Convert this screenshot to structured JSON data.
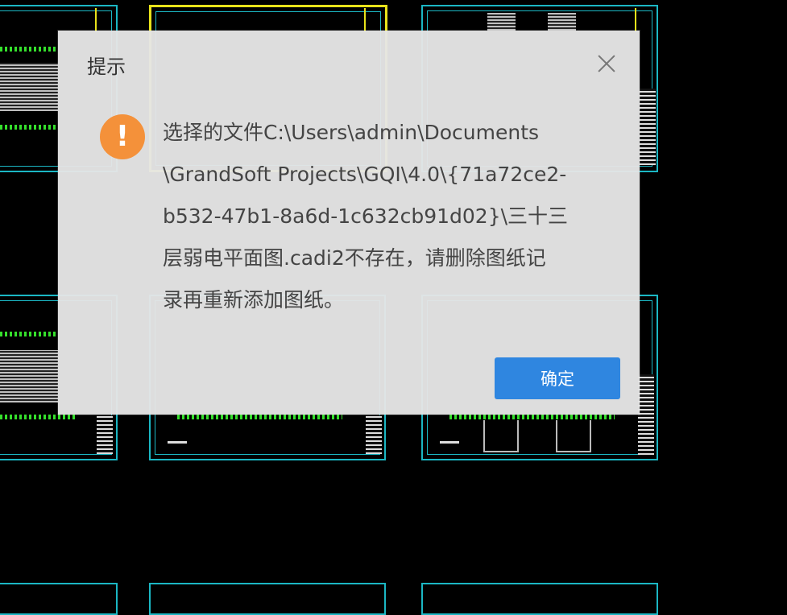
{
  "dialog": {
    "title": "提示",
    "message_lines": [
      "选择的文件C:\\Users\\admin\\Documents",
      "\\GrandSoft Projects\\GQI\\4.0\\{71a72ce2-",
      "b532-47b1-8a6d-1c632cb91d02}\\三十三",
      "层弱电平面图.cadi2不存在，请删除图纸记",
      "录再重新添加图纸。"
    ],
    "ok_label": "确定",
    "icon": "warning-icon",
    "close_icon": "close-icon"
  },
  "colors": {
    "accent": "#2f86e0",
    "warning": "#f4913a",
    "drawing_frame": "#1bb7c4",
    "selection": "#e8e21a",
    "cad_green": "#35e02c"
  }
}
